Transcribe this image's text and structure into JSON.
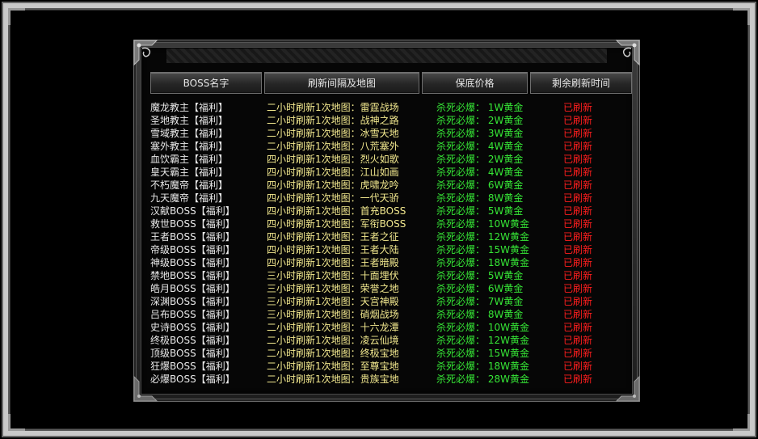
{
  "headers": {
    "name": "BOSS名字",
    "interval": "刷新间隔及地图",
    "price": "保底价格",
    "remaining": "剩余刷新时间"
  },
  "rows": [
    {
      "name": "魔龙教主【福利】",
      "interval": "二小时刷新1次地图：雷霆战场",
      "price": "杀死必爆： 1W黄金",
      "status": "已刷新"
    },
    {
      "name": "圣地教主【福利】",
      "interval": "二小时刷新1次地图：战神之路",
      "price": "杀死必爆： 2W黄金",
      "status": "已刷新"
    },
    {
      "name": "雪域教主【福利】",
      "interval": "二小时刷新1次地图：冰雪天地",
      "price": "杀死必爆： 3W黄金",
      "status": "已刷新"
    },
    {
      "name": "塞外教主【福利】",
      "interval": "二小时刷新1次地图：八荒塞外",
      "price": "杀死必爆： 4W黄金",
      "status": "已刷新"
    },
    {
      "name": "血饮霸主【福利】",
      "interval": "四小时刷新1次地图：烈火如歌",
      "price": "杀死必爆： 2W黄金",
      "status": "已刷新"
    },
    {
      "name": "皇天霸主【福利】",
      "interval": "四小时刷新1次地图：江山如画",
      "price": "杀死必爆： 4W黄金",
      "status": "已刷新"
    },
    {
      "name": "不朽魔帝【福利】",
      "interval": "四小时刷新1次地图：虎啸龙吟",
      "price": "杀死必爆： 6W黄金",
      "status": "已刷新"
    },
    {
      "name": "九天魔帝【福利】",
      "interval": "四小时刷新1次地图：一代天骄",
      "price": "杀死必爆： 8W黄金",
      "status": "已刷新"
    },
    {
      "name": "汉献BOSS【福利】",
      "interval": "四小时刷新1次地图：首充BOSS",
      "price": "杀死必爆： 5W黄金",
      "status": "已刷新"
    },
    {
      "name": "救世BOSS【福利】",
      "interval": "四小时刷新1次地图：军衔BOSS",
      "price": "杀死必爆： 10W黄金",
      "status": "已刷新"
    },
    {
      "name": "王者BOSS【福利】",
      "interval": "四小时刷新1次地图：王者之征",
      "price": "杀死必爆： 12W黄金",
      "status": "已刷新"
    },
    {
      "name": "帝级BOSS【福利】",
      "interval": "四小时刷新1次地图：王者大陆",
      "price": "杀死必爆： 15W黄金",
      "status": "已刷新"
    },
    {
      "name": "神级BOSS【福利】",
      "interval": "四小时刷新1次地图：王者暗殿",
      "price": "杀死必爆： 18W黄金",
      "status": "已刷新"
    },
    {
      "name": "禁地BOSS【福利】",
      "interval": "三小时刷新1次地图：十面埋伏",
      "price": "杀死必爆： 5W黄金",
      "status": "已刷新"
    },
    {
      "name": "皓月BOSS【福利】",
      "interval": "三小时刷新1次地图：荣誉之地",
      "price": "杀死必爆： 6W黄金",
      "status": "已刷新"
    },
    {
      "name": "深渊BOSS【福利】",
      "interval": "三小时刷新1次地图：天宫神殿",
      "price": "杀死必爆： 7W黄金",
      "status": "已刷新"
    },
    {
      "name": "吕布BOSS【福利】",
      "interval": "三小时刷新1次地图：硝烟战场",
      "price": "杀死必爆： 8W黄金",
      "status": "已刷新"
    },
    {
      "name": "史诗BOSS【福利】",
      "interval": "二小时刷新1次地图：十六龙潭",
      "price": "杀死必爆： 10W黄金",
      "status": "已刷新"
    },
    {
      "name": "终极BOSS【福利】",
      "interval": "二小时刷新1次地图：凌云仙境",
      "price": "杀死必爆： 12W黄金",
      "status": "已刷新"
    },
    {
      "name": "顶级BOSS【福利】",
      "interval": "二小时刷新1次地图：终极宝地",
      "price": "杀死必爆： 15W黄金",
      "status": "已刷新"
    },
    {
      "name": "狂爆BOSS【福利】",
      "interval": "二小时刷新1次地图：至尊宝地",
      "price": "杀死必爆： 18W黄金",
      "status": "已刷新"
    },
    {
      "name": "必爆BOSS【福利】",
      "interval": "二小时刷新1次地图：贵族宝地",
      "price": "杀死必爆： 28W黄金",
      "status": "已刷新"
    }
  ],
  "colors": {
    "name": "#e8e8e8",
    "interval": "#f3e98f",
    "price": "#36e636",
    "status": "#ff1e1e"
  }
}
